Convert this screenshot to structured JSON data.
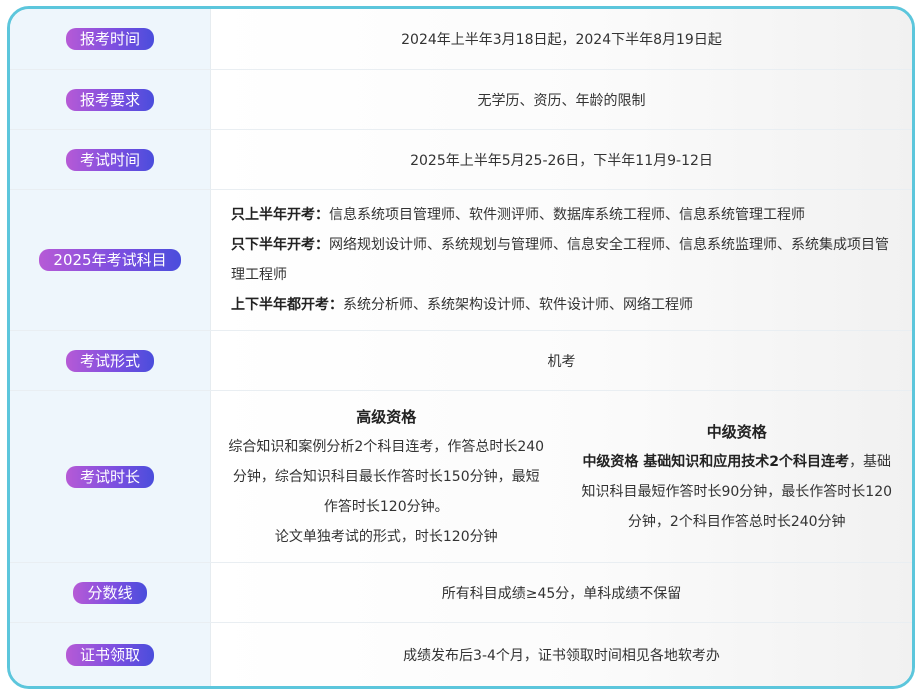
{
  "rows": {
    "registration_time": {
      "label": "报考时间",
      "value": "2024年上半年3月18日起，2024下半年8月19日起"
    },
    "requirements": {
      "label": "报考要求",
      "value": "无学历、资历、年龄的限制"
    },
    "exam_time": {
      "label": "考试时间",
      "value": "2025年上半年5月25-26日，下半年11月9-12日"
    },
    "subjects": {
      "label": "2025年考试科目",
      "first_half_prefix": "只上半年开考：",
      "first_half_list": "信息系统项目管理师、软件测评师、数据库系统工程师、信息系统管理工程师",
      "second_half_prefix": "只下半年开考：",
      "second_half_list": "网络规划设计师、系统规划与管理师、信息安全工程师、信息系统监理师、系统集成项目管理工程师",
      "both_prefix": "上下半年都开考：",
      "both_list": "系统分析师、系统架构设计师、软件设计师、网络工程师"
    },
    "exam_form": {
      "label": "考试形式",
      "value": "机考"
    },
    "duration": {
      "label": "考试时长",
      "senior_title": "高级资格",
      "senior_text": "综合知识和案例分析2个科目连考，作答总时长240分钟，综合知识科目最长作答时长150分钟，最短作答时长120分钟。",
      "senior_text2": "论文单独考试的形式，时长120分钟",
      "mid_title": "中级资格",
      "mid_bold": "中级资格 基础知识和应用技术2个科目连考",
      "mid_text": "，基础知识科目最短作答时长90分钟，最长作答时长120分钟，2个科目作答总时长240分钟"
    },
    "score_line": {
      "label": "分数线",
      "value": "所有科目成绩≥45分，单科成绩不保留"
    },
    "certificate": {
      "label": "证书领取",
      "value": "成绩发布后3-4个月，证书领取时间相见各地软考办"
    }
  },
  "colors": {
    "frame_border": "#5cc6dc",
    "label_bg": "#eef6fc",
    "pill_gradient_start": "#b65ad6",
    "pill_gradient_end": "#4a4ddc"
  }
}
